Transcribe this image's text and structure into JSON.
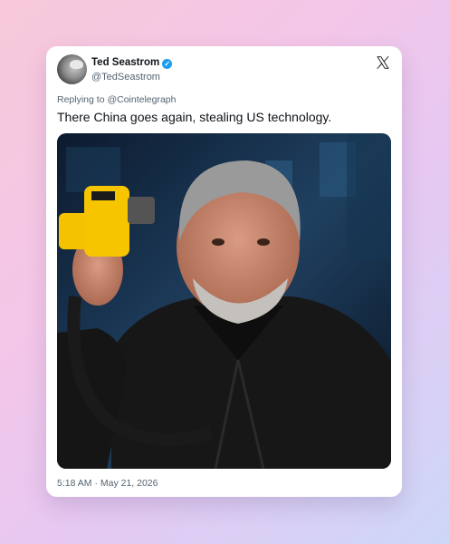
{
  "tweet": {
    "author_name": "Ted Seastrom",
    "author_handle": "@TedSeastrom",
    "replying_to": "Replying to @Cointelegraph",
    "text": "There China goes again, stealing US technology.",
    "timestamp": "5:18 AM · May 21, 2026"
  },
  "icons": {
    "verified": "verified-badge-icon",
    "platform": "x-logo-icon"
  },
  "colors": {
    "verified": "#1d9bf0",
    "text_primary": "#0f1419",
    "text_secondary": "#536471"
  }
}
